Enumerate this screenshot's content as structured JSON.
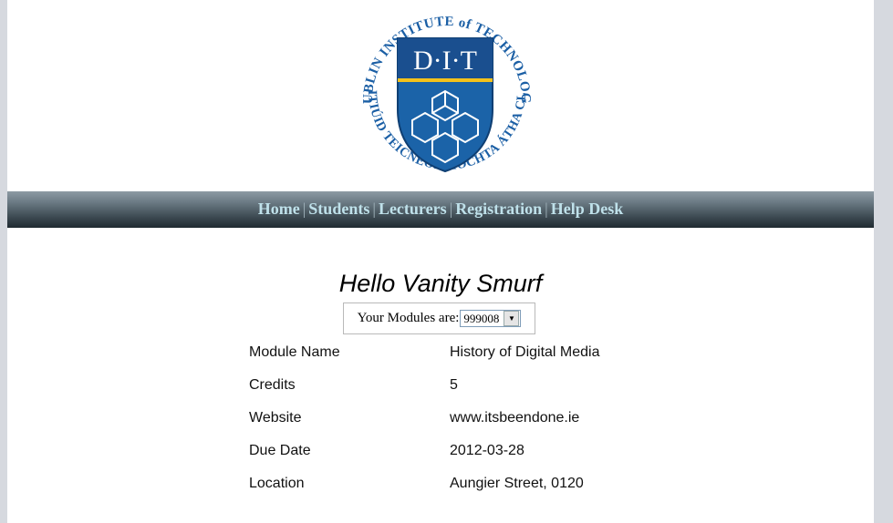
{
  "logo": {
    "text_top": "DUBLIN INSTITUTE of TECHNOLOGY",
    "text_bottom": "INSTITIÚID TEICNEOLAÍOCHTA ÁTHA CLIATH",
    "badge": "D·I·T"
  },
  "nav": {
    "items": [
      {
        "label": "Home"
      },
      {
        "label": "Students"
      },
      {
        "label": "Lecturers"
      },
      {
        "label": "Registration"
      },
      {
        "label": "Help Desk"
      }
    ],
    "separator": "|"
  },
  "greeting": "Hello Vanity Smurf",
  "modules": {
    "label": "Your Modules are:",
    "selected": "999008"
  },
  "details": [
    {
      "label": "Module Name",
      "value": "History of Digital Media"
    },
    {
      "label": "Credits",
      "value": "5"
    },
    {
      "label": "Website",
      "value": "www.itsbeendone.ie"
    },
    {
      "label": "Due Date",
      "value": "2012-03-28"
    },
    {
      "label": "Location",
      "value": "Aungier Street, 0120"
    }
  ],
  "colors": {
    "nav_text": "#bfe1ea",
    "logo_blue": "#1b63a8",
    "logo_yellow": "#f4c21b"
  }
}
